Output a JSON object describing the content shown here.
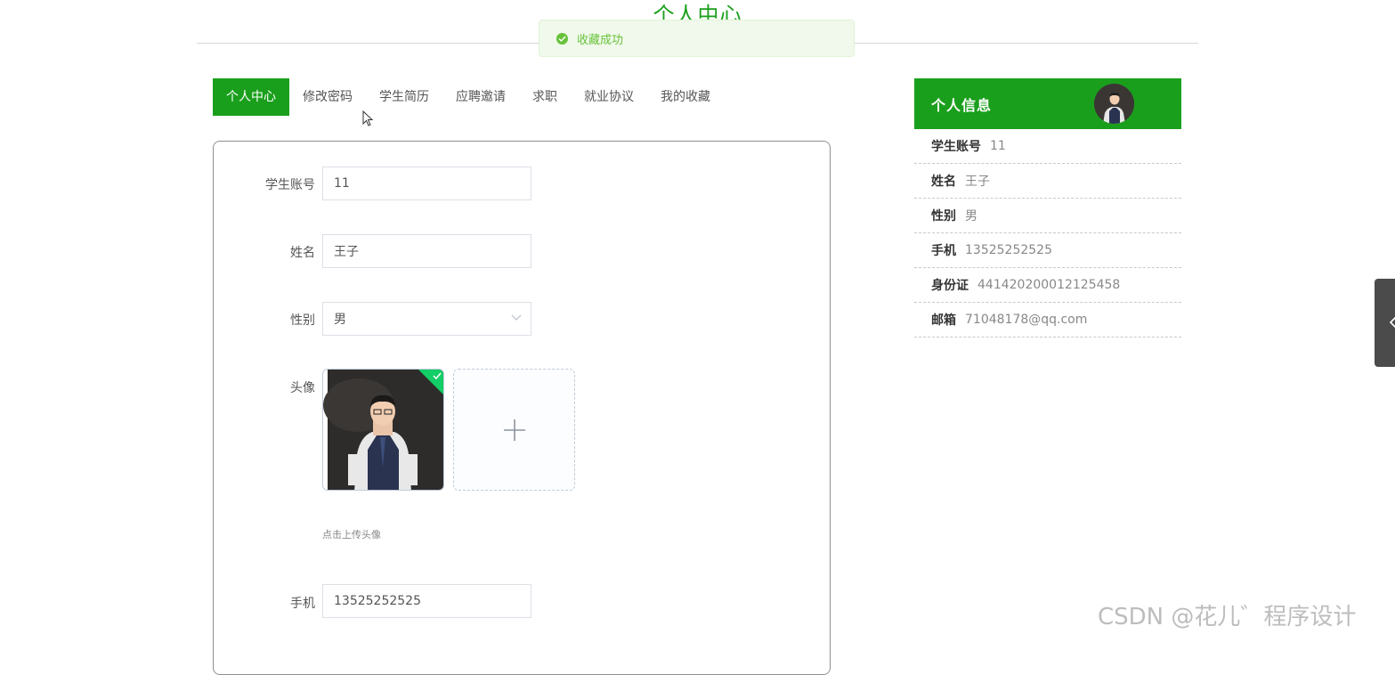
{
  "page": {
    "title": "个人中心"
  },
  "toast": {
    "message": "收藏成功"
  },
  "tabs": [
    {
      "label": "个人中心",
      "active": true
    },
    {
      "label": "修改密码",
      "active": false
    },
    {
      "label": "学生简历",
      "active": false
    },
    {
      "label": "应聘邀请",
      "active": false
    },
    {
      "label": "求职",
      "active": false
    },
    {
      "label": "就业协议",
      "active": false
    },
    {
      "label": "我的收藏",
      "active": false
    }
  ],
  "form": {
    "account_label": "学生账号",
    "account_value": "11",
    "name_label": "姓名",
    "name_value": "王子",
    "gender_label": "性别",
    "gender_value": "男",
    "avatar_label": "头像",
    "avatar_hint": "点击上传头像",
    "phone_label": "手机",
    "phone_value": "13525252525"
  },
  "info": {
    "header": "个人信息",
    "rows": [
      {
        "key": "学生账号",
        "value": "11"
      },
      {
        "key": "姓名",
        "value": "王子"
      },
      {
        "key": "性别",
        "value": "男"
      },
      {
        "key": "手机",
        "value": "13525252525"
      },
      {
        "key": "身份证",
        "value": "441420200012125458"
      },
      {
        "key": "邮箱",
        "value": "71048178@qq.com"
      }
    ]
  },
  "watermark": "CSDN @花儿゛程序设计",
  "colors": {
    "accent": "#1a9f1c",
    "success": "#67c23a"
  }
}
